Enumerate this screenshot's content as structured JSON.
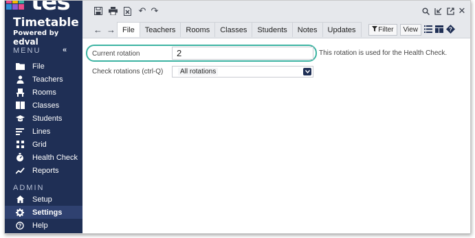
{
  "brand": {
    "logo_text": "tes",
    "title": "Timetable",
    "subtitle_prefix": "Powered by",
    "subtitle_brand": "edval"
  },
  "sidebar": {
    "menu_label": "MENU",
    "collapse_glyph": "«",
    "items": [
      {
        "label": "File",
        "icon": "folder-icon"
      },
      {
        "label": "Teachers",
        "icon": "person-icon"
      },
      {
        "label": "Rooms",
        "icon": "chair-icon"
      },
      {
        "label": "Classes",
        "icon": "book-icon"
      },
      {
        "label": "Students",
        "icon": "graduation-cap-icon"
      },
      {
        "label": "Lines",
        "icon": "lines-icon"
      },
      {
        "label": "Grid",
        "icon": "grid-icon"
      },
      {
        "label": "Health Check",
        "icon": "stopwatch-icon"
      },
      {
        "label": "Reports",
        "icon": "trend-icon"
      }
    ],
    "admin_label": "ADMIN",
    "admin_items": [
      {
        "label": "Setup",
        "icon": "home-icon"
      },
      {
        "label": "Settings",
        "icon": "gear-icon",
        "active": true
      },
      {
        "label": "Help",
        "icon": "question-circle-icon"
      }
    ]
  },
  "toolbar": {
    "icons": [
      "save-icon",
      "print-icon",
      "export-icon",
      "undo-icon",
      "redo-icon"
    ],
    "right_icons": [
      "search-icon",
      "collapse-icon",
      "popout-icon",
      "close-icon"
    ]
  },
  "tabs": [
    {
      "label": "File",
      "active": true
    },
    {
      "label": "Teachers"
    },
    {
      "label": "Rooms"
    },
    {
      "label": "Classes"
    },
    {
      "label": "Students"
    },
    {
      "label": "Notes"
    },
    {
      "label": "Updates"
    }
  ],
  "tools": {
    "filter_label": "Filter",
    "view_label": "View"
  },
  "form": {
    "current_rotation_label": "Current rotation",
    "current_rotation_value": "2",
    "current_rotation_help": "This rotation is used for the Health Check.",
    "check_rotations_label": "Check rotations (ctrl-Q)",
    "check_rotations_value": "All rotations"
  },
  "colors": {
    "sidebar_bg": "#1f2f55",
    "active_item_bg": "#2f4170",
    "highlight_ring": "#3ab3a1",
    "topbar_bg": "#e6e8ec"
  }
}
